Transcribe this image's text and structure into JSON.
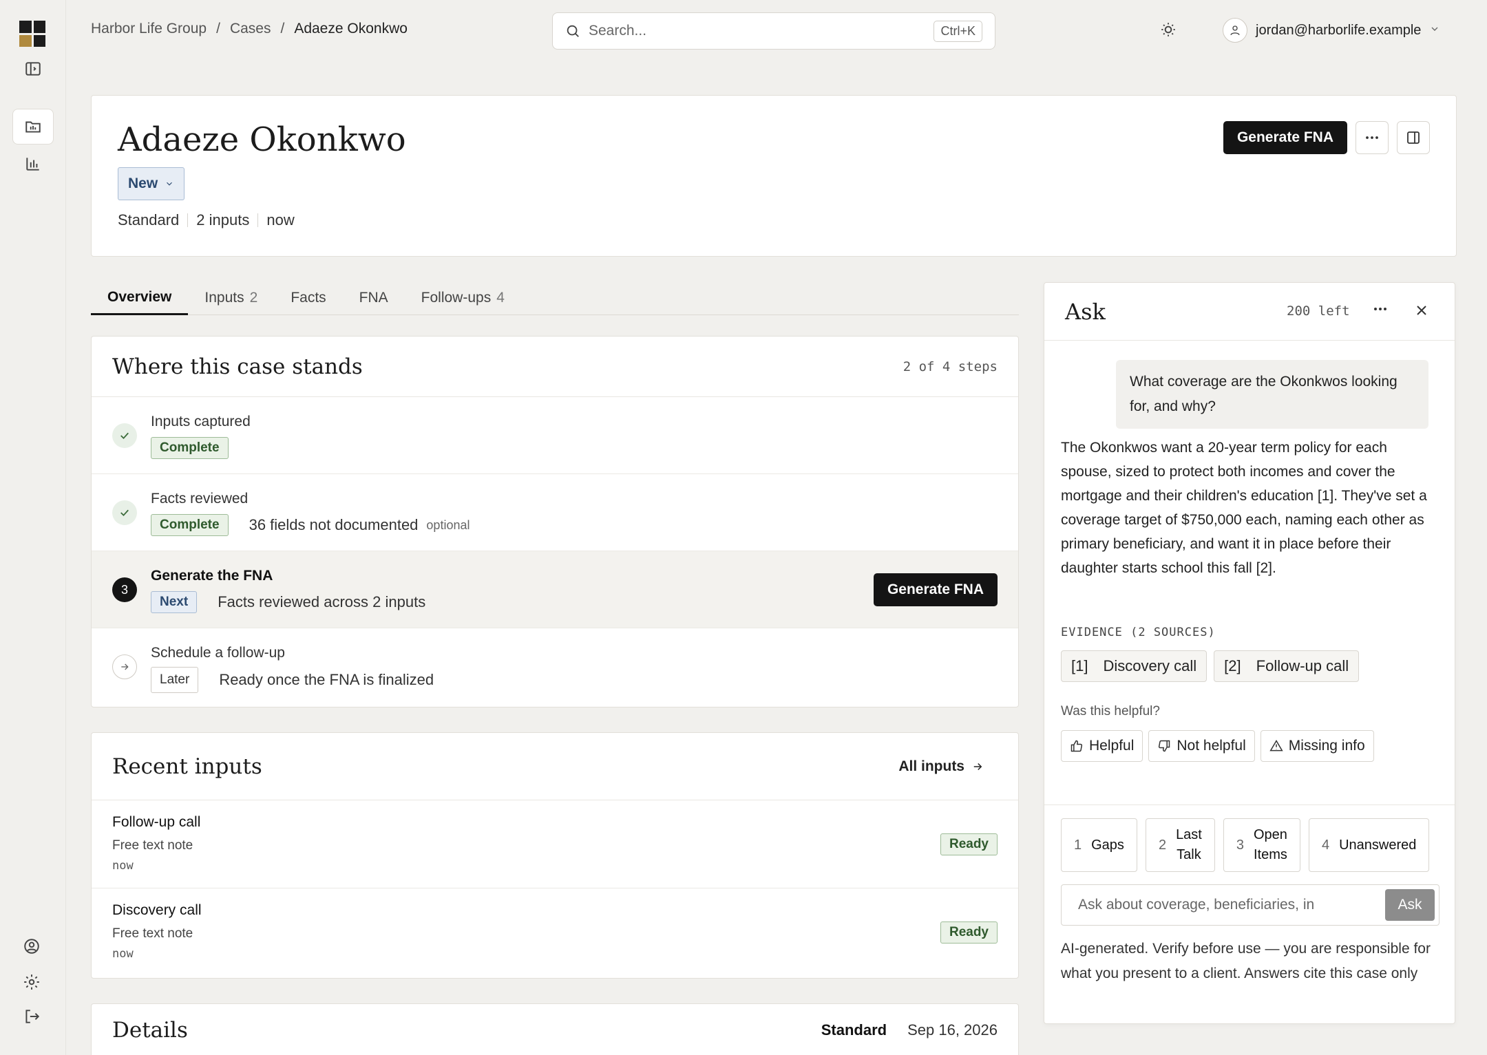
{
  "breadcrumb": {
    "org": "Harbor Life Group",
    "section": "Cases",
    "current": "Adaeze Okonkwo",
    "sep": "/"
  },
  "search": {
    "placeholder": "Search...",
    "shortcut": "Ctrl+K"
  },
  "user": {
    "email": "jordan@harborlife.example"
  },
  "case": {
    "name": "Adaeze Okonkwo",
    "status": "New",
    "meta": [
      "Standard",
      "2 inputs",
      "now"
    ],
    "generate_label": "Generate FNA"
  },
  "tabs": [
    {
      "label": "Overview",
      "count": ""
    },
    {
      "label": "Inputs",
      "count": "2"
    },
    {
      "label": "Facts",
      "count": ""
    },
    {
      "label": "FNA",
      "count": ""
    },
    {
      "label": "Follow-ups",
      "count": "4"
    }
  ],
  "progress": {
    "title": "Where this case stands",
    "count": "2 of 4 steps",
    "steps": [
      {
        "label": "Inputs captured",
        "badge": "Complete",
        "detail": "",
        "note": ""
      },
      {
        "label": "Facts reviewed",
        "badge": "Complete",
        "detail": "36 fields not documented",
        "note": "optional"
      },
      {
        "number": "3",
        "label": "Generate the FNA",
        "badge": "Next",
        "detail": "Facts reviewed across 2 inputs",
        "action": "Generate FNA"
      },
      {
        "label": "Schedule a follow-up",
        "badge": "Later",
        "detail": "Ready once the FNA is finalized"
      }
    ]
  },
  "recent": {
    "title": "Recent inputs",
    "link": "All inputs",
    "items": [
      {
        "title": "Follow-up call",
        "type": "Free text note",
        "time": "now",
        "status": "Ready"
      },
      {
        "title": "Discovery call",
        "type": "Free text note",
        "time": "now",
        "status": "Ready"
      }
    ]
  },
  "details": {
    "title": "Details",
    "plan": "Standard",
    "date": "Sep 16, 2026"
  },
  "ask": {
    "title": "Ask",
    "remaining": "200 left",
    "question": "What coverage are the Okonkwos looking for, and why?",
    "answer": "The Okonkwos want a 20-year term policy for each spouse, sized to protect both incomes and cover the mortgage and their children's education [1]. They've set a coverage target of $750,000 each, naming each other as primary beneficiary, and want it in place before their daughter starts school this fall [2].",
    "evidence_label": "EVIDENCE (2 SOURCES)",
    "evidence": [
      {
        "ref": "[1]",
        "name": "Discovery call"
      },
      {
        "ref": "[2]",
        "name": "Follow-up call"
      }
    ],
    "helpful_q": "Was this helpful?",
    "feedback": [
      "Helpful",
      "Not helpful",
      "Missing info"
    ],
    "suggestions": [
      {
        "n": "1",
        "label": "Gaps"
      },
      {
        "n": "2",
        "label": "Last\nTalk"
      },
      {
        "n": "3",
        "label": "Open\nItems"
      },
      {
        "n": "4",
        "label": "Unanswered"
      }
    ],
    "input_placeholder": "Ask about coverage, beneficiaries, in",
    "send_label": "Ask",
    "disclaimer": "AI-generated. Verify before use — you are responsible for what you present to a client. Answers cite this case only"
  }
}
